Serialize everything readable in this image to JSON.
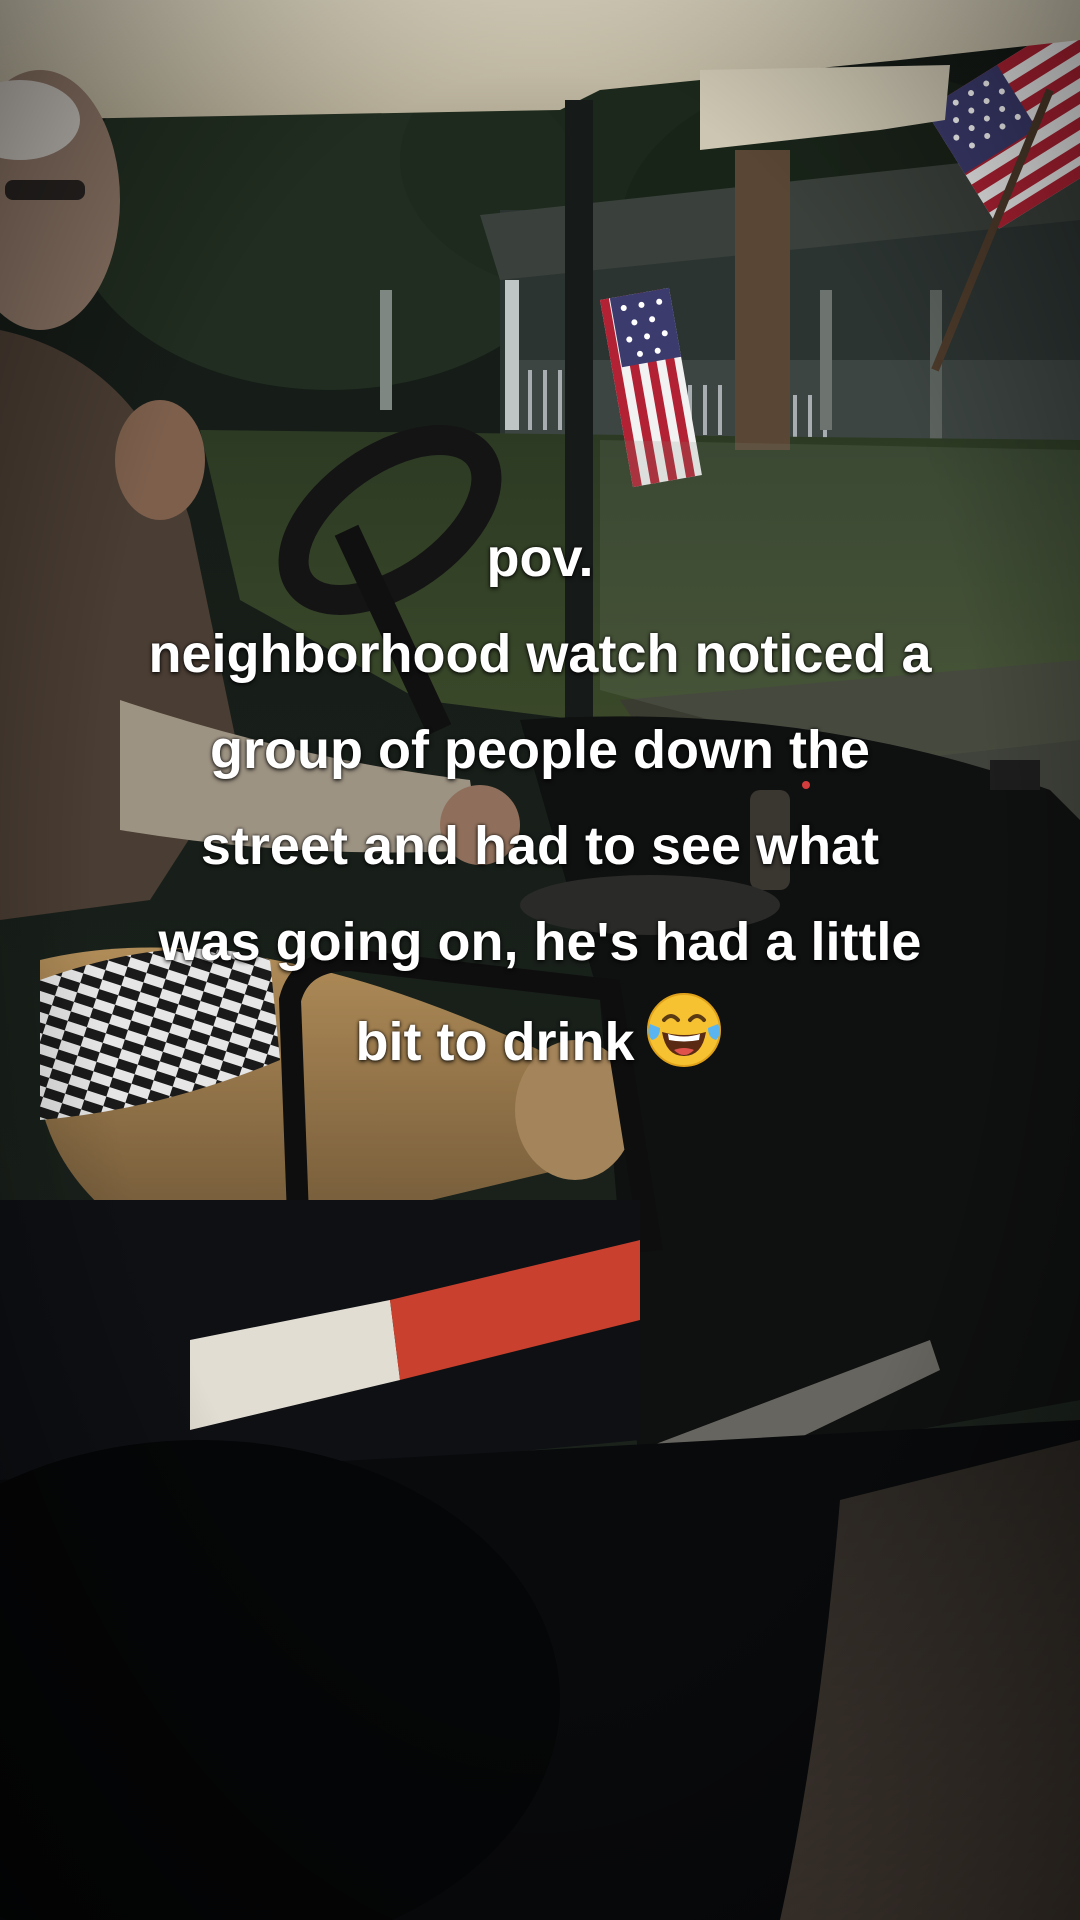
{
  "caption": {
    "lines": [
      "pov.",
      "neighborhood watch noticed a",
      "group of people down the",
      "street and had to see what",
      "was going on, he's had a little",
      "bit to drink"
    ],
    "emoji": "tears-of-joy-emoji"
  },
  "scene": {
    "description_icons": [
      "american-flag-left",
      "american-flag-right"
    ],
    "colors": {
      "flag_red": "#b22234",
      "flag_white": "#f2f2f2",
      "flag_blue": "#3c3b6e",
      "seat_tan": "#9a7a4e",
      "canopy": "#c9c2ae"
    }
  }
}
